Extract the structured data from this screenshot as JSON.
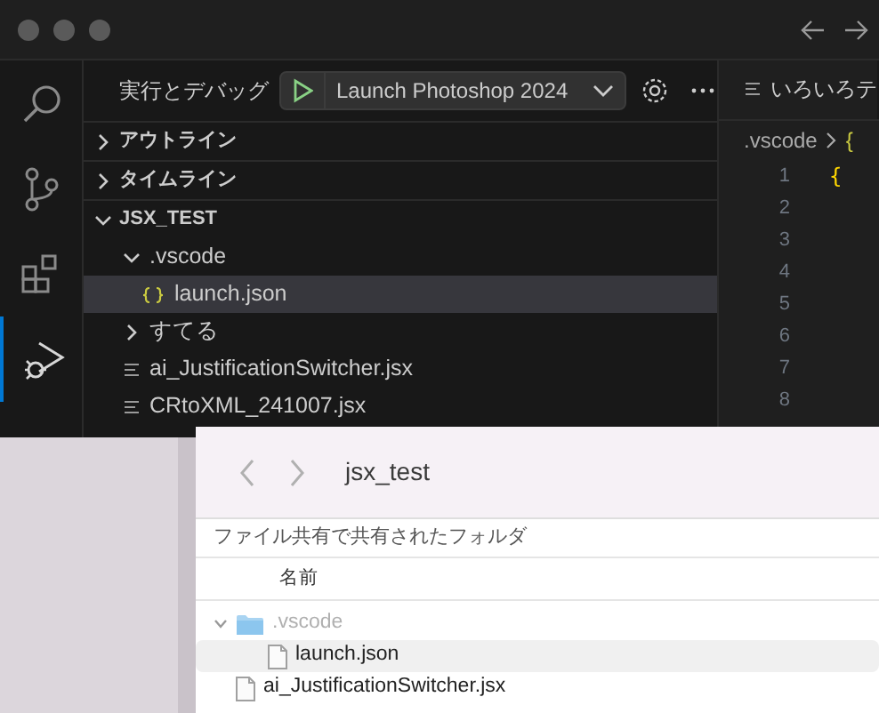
{
  "vscode": {
    "activity_bar": [
      {
        "kind": "search",
        "selected": false
      },
      {
        "kind": "source-control",
        "selected": false
      },
      {
        "kind": "extensions",
        "selected": false
      },
      {
        "kind": "run-debug",
        "selected": true
      }
    ],
    "debug": {
      "title": "実行とデバッグ",
      "config": "Launch Photoshop 2024"
    },
    "sections": [
      {
        "label": "アウトライン",
        "expanded": false
      },
      {
        "label": "タイムライン",
        "expanded": false
      }
    ],
    "explorer": {
      "label": "JSX_TEST",
      "expanded": true,
      "children": [
        {
          "label": ".vscode",
          "kind": "folder",
          "expanded": true,
          "selected": false,
          "children": [
            {
              "label": "launch.json",
              "kind": "json",
              "selected": true
            }
          ]
        },
        {
          "label": "すてる",
          "kind": "folder",
          "expanded": false,
          "selected": false
        },
        {
          "label": "ai_JustificationSwitcher.jsx",
          "kind": "file",
          "selected": false
        },
        {
          "label": "CRtoXML_241007.jsx",
          "kind": "file",
          "selected": false
        }
      ]
    },
    "editor": {
      "tab": "いろいろテ",
      "breadcrumb": [
        ".vscode",
        "{"
      ],
      "line_numbers": [
        "1",
        "2",
        "3",
        "4",
        "5",
        "6",
        "7",
        "8"
      ],
      "code": [
        "{"
      ]
    }
  },
  "finder": {
    "title": "jsx_test",
    "location": "ファイル共有で共有されたフォルダ",
    "column": "名前",
    "rows": [
      {
        "name": ".vscode",
        "kind": "folder",
        "expanded": true,
        "selected": false,
        "dimmed": true,
        "children": [
          {
            "name": "launch.json",
            "kind": "file",
            "selected": true,
            "dimmed": false
          }
        ]
      },
      {
        "name": "ai_JustificationSwitcher.jsx",
        "kind": "file",
        "selected": false,
        "dimmed": false
      }
    ]
  }
}
